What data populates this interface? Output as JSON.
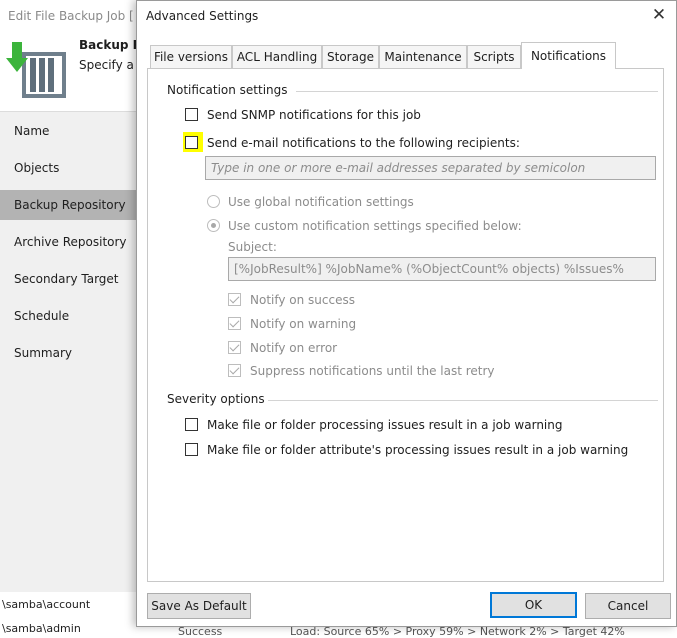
{
  "background_window": {
    "title": "Edit File Backup Job [",
    "header_title": "Backup R",
    "header_subtitle": "Specify a",
    "nav": [
      {
        "label": "Name",
        "active": false
      },
      {
        "label": "Objects",
        "active": false
      },
      {
        "label": "Backup Repository",
        "active": true
      },
      {
        "label": "Archive Repository",
        "active": false
      },
      {
        "label": "Secondary Target",
        "active": false
      },
      {
        "label": "Schedule",
        "active": false
      },
      {
        "label": "Summary",
        "active": false
      }
    ],
    "bottom_rows": [
      "\\samba\\account",
      "\\samba\\admin"
    ],
    "status_text": "Success",
    "log_text": "Load: Source 65% > Proxy 59% > Network 2% > Target 42%"
  },
  "dialog": {
    "title": "Advanced Settings",
    "close_icon": "close-icon",
    "tabs": [
      {
        "label": "File versions",
        "active": false
      },
      {
        "label": "ACL Handling",
        "active": false
      },
      {
        "label": "Storage",
        "active": false
      },
      {
        "label": "Maintenance",
        "active": false
      },
      {
        "label": "Scripts",
        "active": false
      },
      {
        "label": "Notifications",
        "active": true
      }
    ],
    "notification_settings": {
      "title": "Notification settings",
      "snmp_label": "Send SNMP notifications for this job",
      "snmp_checked": false,
      "email_label": "Send e-mail notifications to the following recipients:",
      "email_checked": false,
      "email_placeholder": "Type in one or more e-mail addresses separated by semicolon",
      "email_value": "",
      "use_global_label": "Use global notification settings",
      "use_custom_label": "Use custom notification settings specified below:",
      "selected_option": "custom",
      "subject_label": "Subject:",
      "subject_value": "[%JobResult%] %JobName% (%ObjectCount% objects) %Issues%",
      "notify_success_label": "Notify on success",
      "notify_warning_label": "Notify on warning",
      "notify_error_label": "Notify on error",
      "suppress_label": "Suppress notifications until the last retry"
    },
    "severity_options": {
      "title": "Severity options",
      "processing_issues_label": "Make file or folder processing issues result in a job warning",
      "attribute_issues_label": "Make file or folder attribute's processing issues result in a job warning"
    },
    "buttons": {
      "save_default": "Save As Default",
      "ok": "OK",
      "cancel": "Cancel"
    }
  },
  "colors": {
    "highlight": "#ffff00",
    "primary_border": "#0078d7",
    "active_nav": "#b3b3b3",
    "icon_green": "#3cb43c"
  }
}
